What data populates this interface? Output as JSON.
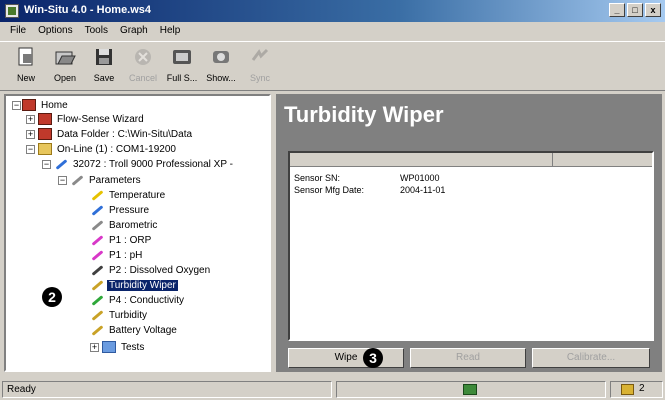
{
  "window": {
    "title": "Win-Situ 4.0 - Home.ws4",
    "min": "_",
    "max": "□",
    "close": "x"
  },
  "menu": [
    "File",
    "Options",
    "Tools",
    "Graph",
    "Help"
  ],
  "toolbar": [
    {
      "label": "New",
      "icon": "new-icon",
      "enabled": true
    },
    {
      "label": "Open",
      "icon": "open-icon",
      "enabled": true
    },
    {
      "label": "Save",
      "icon": "save-icon",
      "enabled": true
    },
    {
      "label": "Cancel",
      "icon": "cancel-icon",
      "enabled": false
    },
    {
      "label": "Full S...",
      "icon": "full-screen-icon",
      "enabled": true
    },
    {
      "label": "Show...",
      "icon": "show-icon",
      "enabled": true
    },
    {
      "label": "Sync",
      "icon": "sync-icon",
      "enabled": false
    }
  ],
  "tree": {
    "home": "Home",
    "flow_sense": "Flow-Sense Wizard",
    "data_folder": "Data Folder : C:\\Win-Situ\\Data",
    "online": "On-Line (1) : COM1-19200",
    "device": "32072 : Troll 9000 Professional XP -",
    "parameters": "Parameters",
    "params": [
      {
        "label": "Temperature",
        "color": "#e6c200"
      },
      {
        "label": "Pressure",
        "color": "#2f6fd8"
      },
      {
        "label": "Barometric",
        "color": "#8a8a8a"
      },
      {
        "label": "P1 : ORP",
        "color": "#d838c8"
      },
      {
        "label": "P1 : pH",
        "color": "#d838c8"
      },
      {
        "label": "P2 : Dissolved Oxygen",
        "color": "#404040"
      },
      {
        "label": "Turbidity Wiper",
        "color": "#c9a227"
      },
      {
        "label": "P4 : Conductivity",
        "color": "#2fa83a"
      },
      {
        "label": "Turbidity",
        "color": "#c9a227"
      },
      {
        "label": "Battery Voltage",
        "color": "#c9a227"
      }
    ],
    "tests": "Tests",
    "selected": "Turbidity Wiper"
  },
  "panel": {
    "title": "Turbidity Wiper",
    "rows": [
      {
        "key": "Sensor SN:",
        "value": "WP01000"
      },
      {
        "key": "Sensor Mfg Date:",
        "value": "2004-11-01"
      }
    ],
    "buttons": [
      {
        "label": "Wipe",
        "enabled": true
      },
      {
        "label": "Read",
        "enabled": false
      },
      {
        "label": "Calibrate...",
        "enabled": false
      }
    ]
  },
  "callouts": {
    "two": "2",
    "three": "3"
  },
  "status": {
    "text": "Ready",
    "right": "2"
  }
}
